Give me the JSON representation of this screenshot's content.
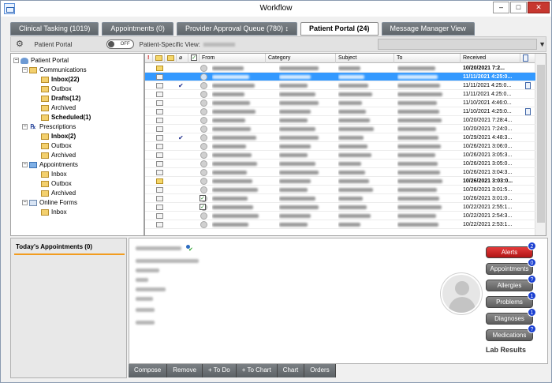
{
  "window": {
    "title": "Workflow",
    "controls": [
      "–",
      "□",
      "✕"
    ]
  },
  "tabs": [
    {
      "label": "Clinical Tasking (1019)"
    },
    {
      "label": "Appointments (0)"
    },
    {
      "label": "Provider Approval Queue (780) ↕"
    },
    {
      "label": "Patient Portal (24)"
    },
    {
      "label": "Message Manager View"
    }
  ],
  "toolbar": {
    "title": "Patient Portal",
    "toggle": "OFF",
    "view_label": "Patient-Specific View:"
  },
  "tree": {
    "root": "Patient Portal",
    "groups": [
      {
        "label": "Communications",
        "children": [
          "Inbox(22)",
          "Outbox",
          "Drafts(12)",
          "Archived",
          "Scheduled(1)"
        ]
      },
      {
        "label": "Prescriptions",
        "children": [
          "Inbox(2)",
          "Outbox",
          "Archived"
        ]
      },
      {
        "label": "Appointments",
        "children": [
          "Inbox",
          "Outbox",
          "Archived"
        ]
      },
      {
        "label": "Online Forms",
        "children": [
          "Inbox"
        ]
      }
    ]
  },
  "grid": {
    "columns": [
      "!",
      "",
      "",
      "",
      "",
      "From",
      "Category",
      "Subject",
      "To",
      "Received",
      ""
    ],
    "rows": [
      {
        "received": "10/20/2021 7:2...",
        "bold": true,
        "check": false,
        "cb": false,
        "doc": false,
        "env": "yellow"
      },
      {
        "received": "11/11/2021 4:25:0...",
        "bold": true,
        "check": false,
        "cb": false,
        "doc": false,
        "env": "plain",
        "selected": true
      },
      {
        "received": "11/11/2021 4:25:0...",
        "bold": false,
        "check": true,
        "cb": false,
        "doc": true,
        "env": "plain"
      },
      {
        "received": "11/11/2021 4:25:0...",
        "bold": false,
        "check": false,
        "cb": false,
        "doc": false,
        "env": "plain"
      },
      {
        "received": "11/10/2021 4:46:0...",
        "bold": false,
        "check": false,
        "cb": false,
        "doc": false,
        "env": "plain"
      },
      {
        "received": "11/10/2021 4:25:0...",
        "bold": false,
        "check": false,
        "cb": false,
        "doc": true,
        "env": "plain"
      },
      {
        "received": "10/20/2021 7:28:4...",
        "bold": false,
        "check": false,
        "cb": false,
        "doc": false,
        "env": "plain"
      },
      {
        "received": "10/20/2021 7:24:0...",
        "bold": false,
        "check": false,
        "cb": false,
        "doc": false,
        "env": "plain"
      },
      {
        "received": "10/29/2021 4:48:3...",
        "bold": false,
        "check": true,
        "cb": false,
        "doc": false,
        "env": "plain"
      },
      {
        "received": "10/26/2021 3:06:0...",
        "bold": false,
        "check": false,
        "cb": false,
        "doc": false,
        "env": "plain"
      },
      {
        "received": "10/26/2021 3:05:3...",
        "bold": false,
        "check": false,
        "cb": false,
        "doc": false,
        "env": "plain"
      },
      {
        "received": "10/26/2021 3:05:0...",
        "bold": false,
        "check": false,
        "cb": false,
        "doc": false,
        "env": "plain"
      },
      {
        "received": "10/26/2021 3:04:3...",
        "bold": false,
        "check": false,
        "cb": false,
        "doc": false,
        "env": "plain"
      },
      {
        "received": "10/26/2021 3:03:0...",
        "bold": true,
        "check": false,
        "cb": false,
        "doc": false,
        "env": "yellow"
      },
      {
        "received": "10/26/2021 3:01:5...",
        "bold": false,
        "check": false,
        "cb": false,
        "doc": false,
        "env": "plain"
      },
      {
        "received": "10/26/2021 3:01:0...",
        "bold": false,
        "check": false,
        "cb": true,
        "doc": false,
        "env": "plain"
      },
      {
        "received": "10/22/2021 2:55:1...",
        "bold": false,
        "check": false,
        "cb": true,
        "doc": false,
        "env": "plain"
      },
      {
        "received": "10/22/2021 2:54:3...",
        "bold": false,
        "check": false,
        "cb": false,
        "doc": false,
        "env": "plain"
      },
      {
        "received": "10/22/2021 2:53:1...",
        "bold": false,
        "check": false,
        "cb": false,
        "doc": false,
        "env": "plain"
      }
    ]
  },
  "appointments_panel": {
    "title": "Today's Appointments (0)"
  },
  "detail": {
    "buttons": [
      {
        "label": "Alerts",
        "badge": "2",
        "red": true
      },
      {
        "label": "Appointments",
        "badge": "0"
      },
      {
        "label": "Allergies",
        "badge": "?"
      },
      {
        "label": "Problems",
        "badge": "1"
      },
      {
        "label": "Diagnoses",
        "badge": "1"
      },
      {
        "label": "Medications",
        "badge": "?"
      }
    ],
    "lab_results": "Lab Results"
  },
  "actions": [
    "Compose",
    "Remove",
    "+ To Do",
    "+ To Chart",
    "Chart",
    "Orders"
  ],
  "colors": {
    "accent": "#3399ff",
    "orange_line": "#f29c1f",
    "alert_red": "#cc2020",
    "badge_blue": "#1a3fd1"
  }
}
